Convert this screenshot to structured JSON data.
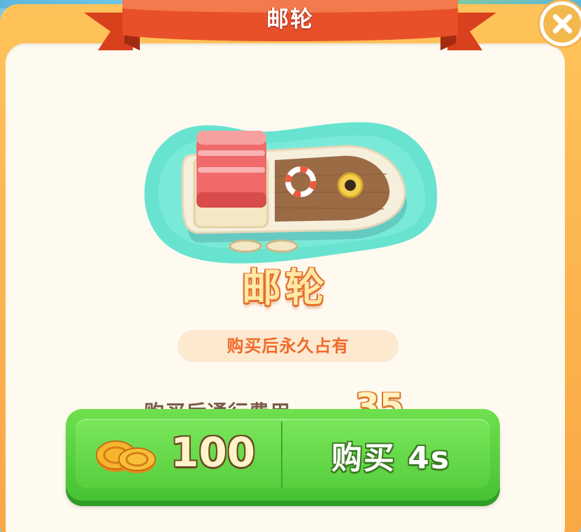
{
  "dialog": {
    "title": "邮轮",
    "item_name": "邮轮",
    "permanent_note": "购买后永久占有",
    "toll_label": "购买后通行费用",
    "toll_value": "35"
  },
  "buy_button": {
    "price": "100",
    "label": "购买 4s",
    "currency_icon": "gold-coins-icon"
  },
  "close_icon": "close-icon",
  "illustration": "cruise-ship-illustration",
  "colors": {
    "frame": "#f9a743",
    "panel": "#fffaf0",
    "ribbon": "#e84a22",
    "button_green": "#58cf3e",
    "accent_orange": "#f06a2a"
  }
}
